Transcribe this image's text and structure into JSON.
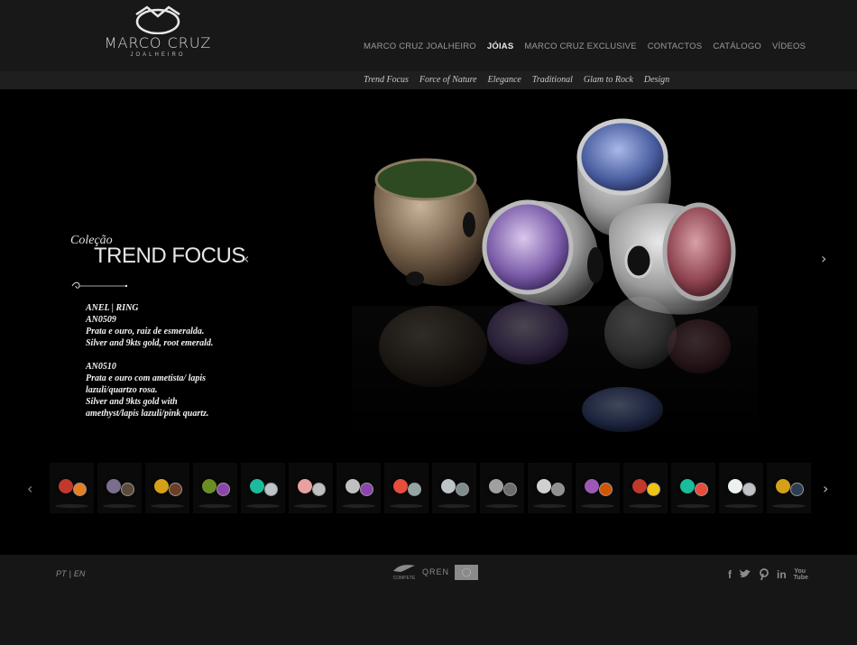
{
  "brand": {
    "name": "MARCO CRUZ",
    "sub": "JOALHEIRO"
  },
  "nav": [
    {
      "label": "MARCO CRUZ JOALHEIRO",
      "active": false
    },
    {
      "label": "JÓIAS",
      "active": true
    },
    {
      "label": "MARCO CRUZ EXCLUSIVE",
      "active": false
    },
    {
      "label": "CONTACTOS",
      "active": false
    },
    {
      "label": "CATÁLOGO",
      "active": false
    },
    {
      "label": "VÍDEOS",
      "active": false
    }
  ],
  "subnav": [
    "Trend Focus",
    "Force of Nature",
    "Elegance",
    "Traditional",
    "Glam to Rock",
    "Design"
  ],
  "collection": {
    "prefix": "Coleção",
    "title": "TREND FOCUS"
  },
  "description": {
    "block1": [
      "ANEL | RING",
      "AN0509",
      "Prata e ouro, raiz de esmeralda.",
      "Silver and 9kts gold, root emerald."
    ],
    "block2": [
      "AN0510",
      "Prata e ouro com ametista/ lapis",
      "lazuli/quartzo rosa.",
      "Silver and 9kts gold with",
      "amethyst/lapis lazuli/pink quartz."
    ]
  },
  "arrows": {
    "left": "‹",
    "right": "›"
  },
  "thumbnails": [
    {
      "name": "thumb-1",
      "colors": [
        "#c0392b",
        "#e67e22"
      ]
    },
    {
      "name": "thumb-2",
      "colors": [
        "#7b6d8d",
        "#5a4a3a"
      ]
    },
    {
      "name": "thumb-3",
      "colors": [
        "#d4a017",
        "#6b3e26"
      ]
    },
    {
      "name": "thumb-4",
      "colors": [
        "#6b8e23",
        "#8e44ad"
      ]
    },
    {
      "name": "thumb-5",
      "colors": [
        "#1abc9c",
        "#bdc3c7"
      ]
    },
    {
      "name": "thumb-6",
      "colors": [
        "#e8a0a0",
        "#c0c0c0"
      ]
    },
    {
      "name": "thumb-7",
      "colors": [
        "#c0c0c0",
        "#8e44ad"
      ]
    },
    {
      "name": "thumb-8",
      "colors": [
        "#e74c3c",
        "#95a5a6"
      ]
    },
    {
      "name": "thumb-9",
      "colors": [
        "#bdc3c7",
        "#7f8c8d"
      ]
    },
    {
      "name": "thumb-10",
      "colors": [
        "#a0a0a0",
        "#6d6d6d"
      ]
    },
    {
      "name": "thumb-11",
      "colors": [
        "#d0d0d0",
        "#909090"
      ]
    },
    {
      "name": "thumb-12",
      "colors": [
        "#9b59b6",
        "#d35400"
      ]
    },
    {
      "name": "thumb-13",
      "colors": [
        "#c0392b",
        "#f1c40f"
      ]
    },
    {
      "name": "thumb-14",
      "colors": [
        "#1abc9c",
        "#e74c3c"
      ]
    },
    {
      "name": "thumb-15",
      "colors": [
        "#ecf0f1",
        "#bdc3c7"
      ]
    },
    {
      "name": "thumb-16",
      "colors": [
        "#d4a017",
        "#2c3e50"
      ]
    },
    {
      "name": "thumb-17",
      "colors": [
        "#a0a0a0",
        "#444"
      ]
    }
  ],
  "footer": {
    "lang_pt": "PT",
    "lang_sep": "|",
    "lang_en": "EN",
    "compete": "COMPETE",
    "qren": "QREN",
    "social": [
      "f",
      "t",
      "p",
      "in",
      "You Tube"
    ]
  },
  "colors": {
    "background": "#000000",
    "header": "#181818",
    "subbar": "#1f1f1f",
    "footer": "#161616",
    "text": "#e6e6e6"
  },
  "icons": {
    "logo": "crown-logo-icon",
    "prev": "chevron-left-icon",
    "next": "chevron-right-icon",
    "facebook": "facebook-icon",
    "twitter": "twitter-icon",
    "pinterest": "pinterest-icon",
    "linkedin": "linkedin-icon",
    "youtube": "youtube-icon"
  }
}
